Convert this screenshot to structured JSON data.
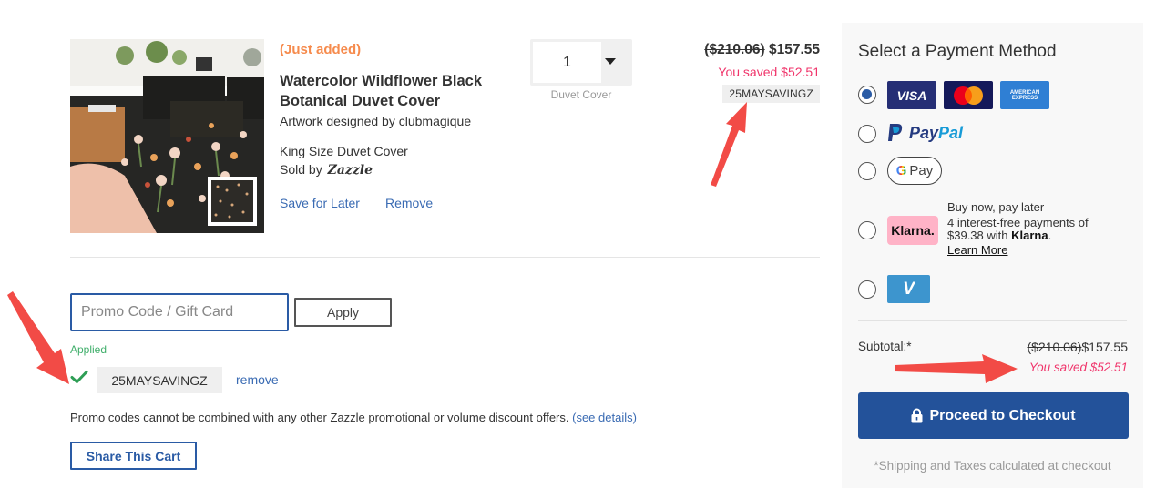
{
  "item": {
    "status": "(Just added)",
    "title": "Watercolor Wildflower Black Botanical Duvet Cover",
    "artwork_credit": "Artwork designed by clubmagique",
    "size": "King Size Duvet Cover",
    "sold_by_prefix": "Sold by",
    "sold_by_brand": "Zazzle",
    "save_for_later": "Save for Later",
    "remove": "Remove",
    "quantity": "1",
    "quantity_label": "Duvet Cover",
    "original_price": "($210.06)",
    "price": "$157.55",
    "saved": "You saved $52.51",
    "applied_code_tag": "25MAYSAVINGZ",
    "image_alt": "duvet-cover-bedroom-photo"
  },
  "promo": {
    "placeholder": "Promo Code / Gift Card",
    "value": "",
    "apply_label": "Apply",
    "applied_label": "Applied",
    "applied_code": "25MAYSAVINGZ",
    "remove_label": "remove",
    "disclaimer": "Promo codes cannot be combined with any other Zazzle promotional or volume discount offers.",
    "see_details": "(see details)",
    "share_cart_label": "Share This Cart"
  },
  "payment": {
    "title": "Select a Payment Method",
    "selected": "card",
    "methods": [
      {
        "id": "card",
        "cards": [
          "VISA",
          "Mastercard",
          "American Express"
        ]
      },
      {
        "id": "paypal",
        "label_part1": "Pay",
        "label_part2": "Pal"
      },
      {
        "id": "gpay",
        "label_g": "G",
        "label": "Pay"
      },
      {
        "id": "klarna",
        "logo": "Klarna.",
        "headline": "Buy now, pay later",
        "line1": "4 interest-free payments of",
        "line2_amount": "$39.38 with",
        "line2_brand": "Klarna",
        "learn_more": "Learn More"
      },
      {
        "id": "venmo",
        "logo": "V"
      }
    ],
    "amex_line1": "AMERICAN",
    "amex_line2": "EXPRESS",
    "subtotal_label": "Subtotal:*",
    "subtotal_original": "($210.06)",
    "subtotal": "$157.55",
    "saved": "You saved $52.51",
    "checkout_label": "Proceed to Checkout",
    "note": "*Shipping and Taxes calculated at checkout"
  },
  "colors": {
    "accent_blue": "#23529a",
    "link_blue": "#3a6bb3",
    "saved_pink": "#f0356b",
    "just_added_orange": "#f68b4d",
    "applied_green": "#3fae6a",
    "annotation_red": "#f24b46"
  }
}
